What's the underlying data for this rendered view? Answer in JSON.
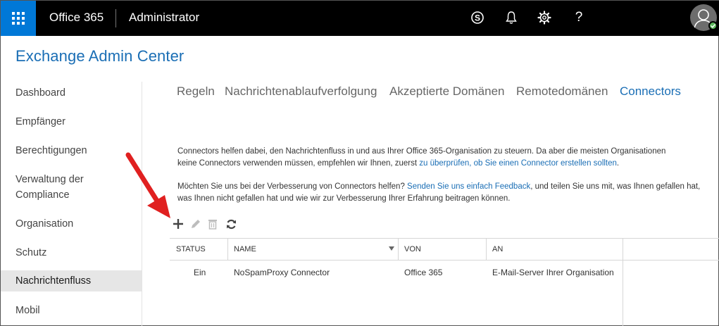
{
  "topbar": {
    "app_title": "Office 365",
    "section_title": "Administrator",
    "icons": [
      "waffle-icon",
      "skype-icon",
      "bell-icon",
      "gear-icon",
      "help-icon",
      "avatar"
    ],
    "help_label": "?",
    "accent": "#0078d7"
  },
  "header": {
    "title": "Exchange Admin Center",
    "color": "#1a6eb5"
  },
  "leftnav": {
    "items": [
      {
        "label": "Dashboard"
      },
      {
        "label": "Empfänger"
      },
      {
        "label": "Berechtigungen"
      },
      {
        "label": "Verwaltung der"
      },
      {
        "label": "Compliance"
      },
      {
        "label": "Organisation"
      },
      {
        "label": "Schutz"
      },
      {
        "label": "Nachrichtenfluss",
        "active": true
      },
      {
        "label": "Mobil"
      }
    ]
  },
  "tabs": [
    {
      "label": "Regeln"
    },
    {
      "label": "Nachrichtenablaufverfolgung"
    },
    {
      "label": "Akzeptierte Domänen"
    },
    {
      "label": "Remotedomänen"
    },
    {
      "label": "Connectors",
      "active": true
    }
  ],
  "description": {
    "p1_line1": "Connectors helfen dabei, den Nachrichtenfluss in und aus Ihrer Office 365-Organisation zu steuern. Da aber die meisten Organisationen",
    "p1_line2_prefix": "keine Connectors verwenden müssen, empfehlen wir Ihnen, zuerst ",
    "p1_line2_link": "zu überprüfen, ob Sie einen Connector erstellen sollten",
    "p1_line2_suffix": ".",
    "p2_line1_prefix": "Möchten Sie uns bei der Verbesserung von Connectors helfen? ",
    "p2_line1_link": "Senden Sie uns einfach Feedback",
    "p2_line1_suffix": ", und teilen Sie uns mit, was Ihnen gefallen hat,",
    "p2_line2": "was Ihnen nicht gefallen hat und wie wir zur Verbesserung Ihrer Erfahrung beitragen können."
  },
  "toolbar": {
    "icons": [
      "add-icon",
      "edit-icon",
      "delete-icon",
      "refresh-icon"
    ]
  },
  "table": {
    "columns": [
      "STATUS",
      "NAME",
      "VON",
      "AN"
    ],
    "rows": [
      {
        "status": "Ein",
        "name": "NoSpamProxy Connector",
        "von": "Office 365",
        "an": "E-Mail-Server Ihrer Organisation"
      }
    ]
  },
  "annotation_color": "#e02020"
}
